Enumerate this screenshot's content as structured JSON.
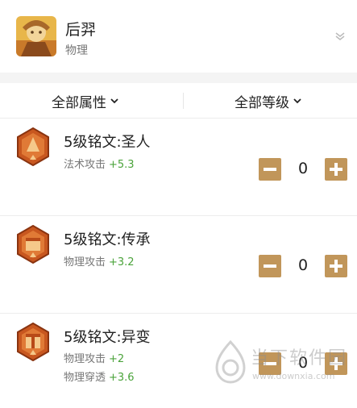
{
  "hero": {
    "name": "后羿",
    "type": "物理"
  },
  "filters": {
    "attribute_label": "全部属性",
    "level_label": "全部等级"
  },
  "runes": [
    {
      "title": "5级铭文:圣人",
      "stats": [
        {
          "label": "法术攻击",
          "value": "+5.3"
        }
      ],
      "count": "0"
    },
    {
      "title": "5级铭文:传承",
      "stats": [
        {
          "label": "物理攻击",
          "value": "+3.2"
        }
      ],
      "count": "0"
    },
    {
      "title": "5级铭文:异变",
      "stats": [
        {
          "label": "物理攻击",
          "value": "+2"
        },
        {
          "label": "物理穿透",
          "value": "+3.6"
        }
      ],
      "count": "0"
    }
  ],
  "watermark": {
    "text": "当下软件园",
    "url": "www.downxia.com"
  },
  "colors": {
    "accent": "#c1965a",
    "stat_value": "#4aa33a",
    "rune_badge": "#c8571f"
  }
}
